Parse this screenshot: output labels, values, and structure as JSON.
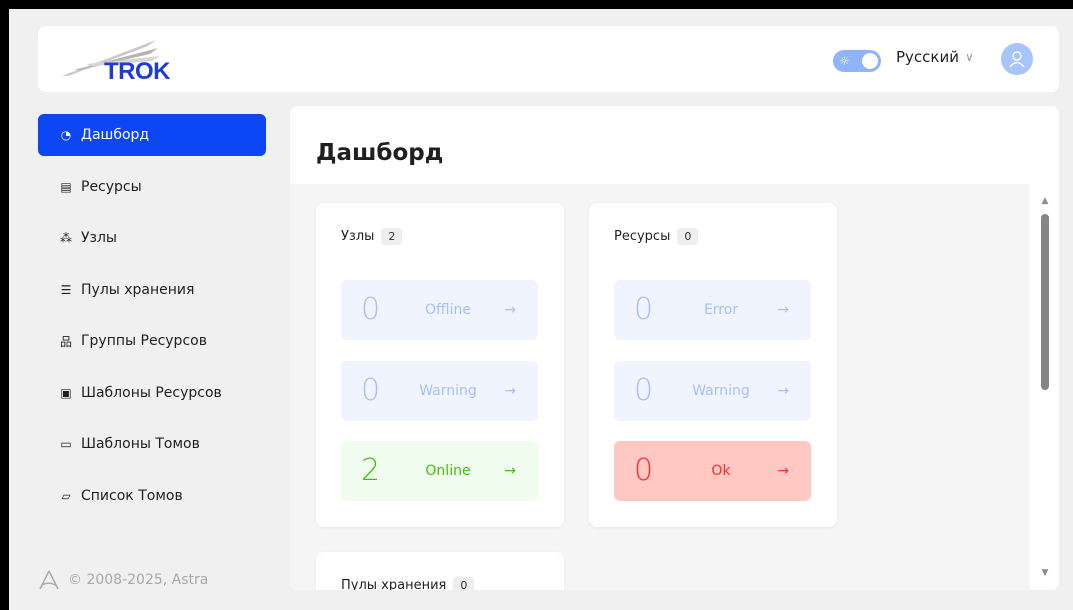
{
  "header": {
    "logo_text": "TROK",
    "language": "Русский",
    "colors": {
      "toggle": "#8fb4fb",
      "avatar": "#a7c4fb"
    }
  },
  "sidebar": {
    "items": [
      {
        "label": "Дашборд",
        "icon": "pie-chart-icon",
        "active": true
      },
      {
        "label": "Ресурсы",
        "icon": "database-icon"
      },
      {
        "label": "Узлы",
        "icon": "nodes-icon"
      },
      {
        "label": "Пулы хранения",
        "icon": "storage-pool-icon"
      },
      {
        "label": "Группы Ресурсов",
        "icon": "group-icon"
      },
      {
        "label": "Шаблоны Ресурсов",
        "icon": "template-icon"
      },
      {
        "label": "Шаблоны Томов",
        "icon": "folder-icon"
      },
      {
        "label": "Список Томов",
        "icon": "drive-icon"
      }
    ],
    "accent": "#0d47f5"
  },
  "footer": {
    "text": "© 2008-2025, Astra"
  },
  "main": {
    "title": "Дашборд",
    "cards": [
      {
        "title": "Узлы",
        "count": "2",
        "stats": [
          {
            "value": "0",
            "label": "Offline",
            "status": "neutral"
          },
          {
            "value": "0",
            "label": "Warning",
            "status": "neutral"
          },
          {
            "value": "2",
            "label": "Online",
            "status": "good"
          }
        ]
      },
      {
        "title": "Ресурсы",
        "count": "0",
        "stats": [
          {
            "value": "0",
            "label": "Error",
            "status": "neutral"
          },
          {
            "value": "0",
            "label": "Warning",
            "status": "neutral"
          },
          {
            "value": "0",
            "label": "Ok",
            "status": "bad"
          }
        ]
      },
      {
        "title": "Пулы хранения",
        "count": "0"
      }
    ],
    "arrow": "→"
  }
}
